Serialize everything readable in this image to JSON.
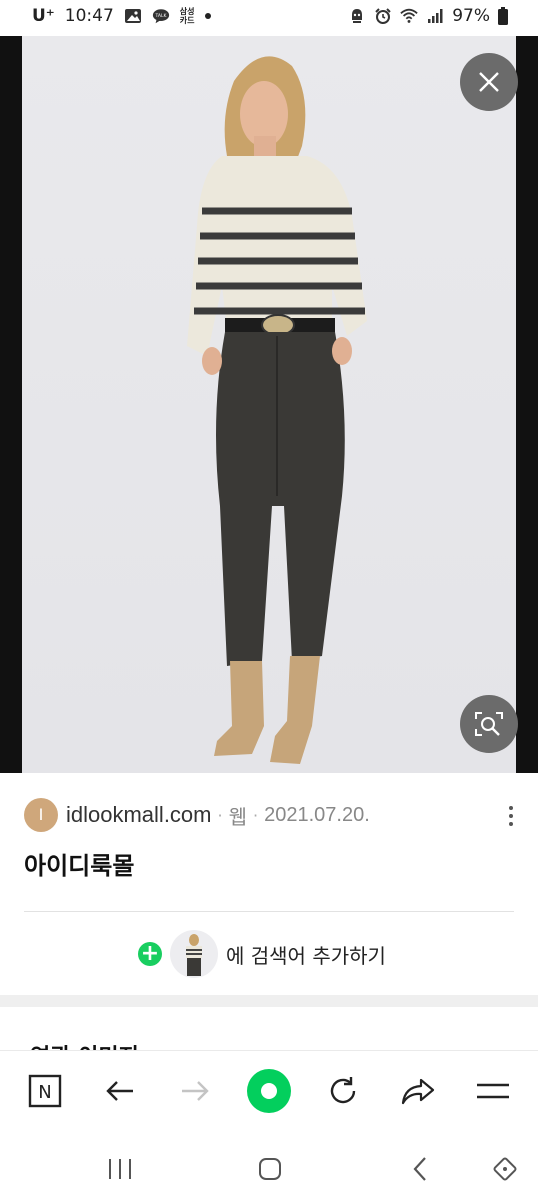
{
  "status_bar": {
    "carrier": "U⁺",
    "time": "10:47",
    "samsung_card_line1": "삼성",
    "samsung_card_line2": "카드",
    "battery": "97%",
    "icons": [
      "gallery-icon",
      "kakaotalk-icon",
      "samsung-card-icon",
      "notification-dot",
      "alarm-guard-icon",
      "alarm-clock-icon",
      "wifi-icon",
      "signal-icon",
      "battery-icon"
    ]
  },
  "viewer": {
    "close_icon": "close-icon",
    "lens_icon": "image-search-icon"
  },
  "result": {
    "favicon_letter": "I",
    "domain": "idlookmall.com",
    "separator": "·",
    "type": "웹",
    "date": "2021.07.20.",
    "title": "아이디룩몰",
    "add_search_label": "에 검색어 추가하기"
  },
  "related": {
    "title": "연관 이미지"
  },
  "toolbar": {
    "n_label": "N",
    "icons": [
      "naver-n-icon",
      "back-arrow-icon",
      "forward-arrow-icon",
      "green-dot-icon",
      "reload-icon",
      "share-icon",
      "menu-icon"
    ]
  },
  "nav_bar": {
    "icons": [
      "recents-icon",
      "home-icon",
      "back-icon",
      "rotate-icon"
    ]
  },
  "colors": {
    "naver_green": "#03cf5d",
    "plus_green": "#19ce60",
    "favicon": "#cfa77b",
    "overlay_button": "#6b6b6b"
  }
}
